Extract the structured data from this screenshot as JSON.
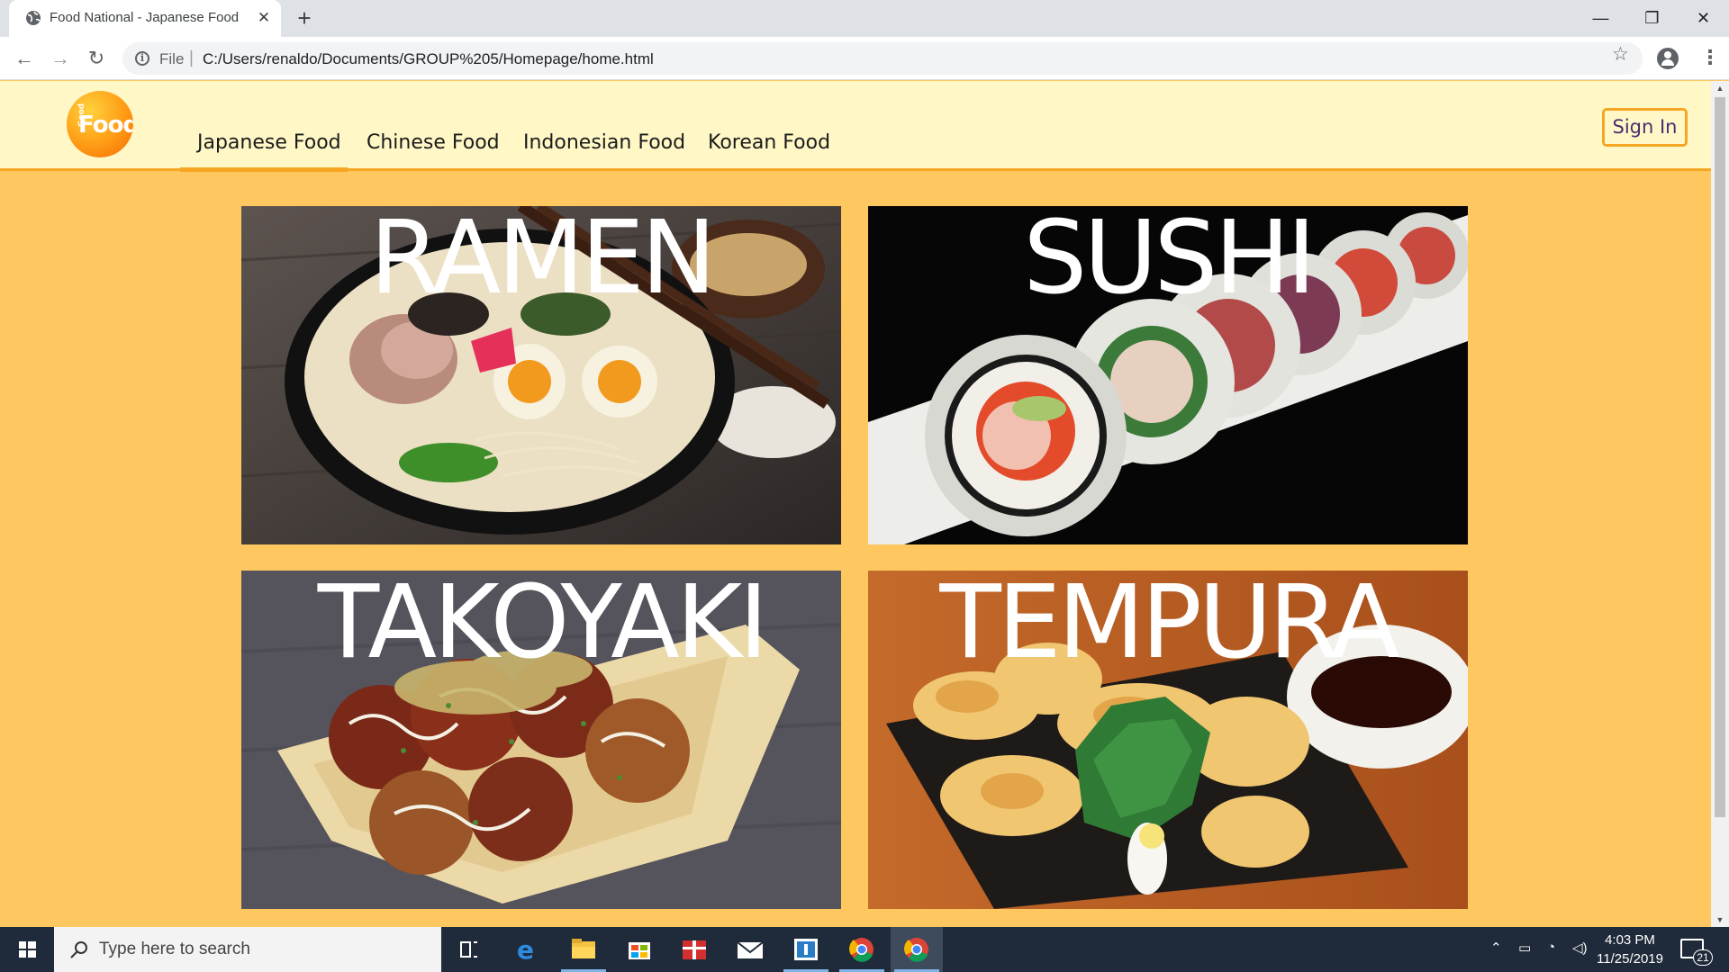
{
  "browser": {
    "tab_title": "Food National - Japanese Food",
    "tab_close": "✕",
    "new_tab": "+",
    "window_controls": {
      "minimize": "—",
      "restore": "❐",
      "close": "✕"
    },
    "scheme_label": "File",
    "url": "C:/Users/renaldo/Documents/GROUP%205/Homepage/home.html",
    "back": "←",
    "forward": "→",
    "reload": "↻",
    "star": "☆",
    "menu": "⋮"
  },
  "site": {
    "logo_text": "Food",
    "logo_small": "Good",
    "nav": [
      {
        "label": "Japanese Food",
        "active": true
      },
      {
        "label": "Chinese Food",
        "active": false
      },
      {
        "label": "Indonesian Food",
        "active": false
      },
      {
        "label": "Korean Food",
        "active": false
      }
    ],
    "sign_in": "Sign In",
    "accent_color": "#f5a623",
    "page_bg": "#ffc760",
    "header_bg": "#fff8c6"
  },
  "cards": [
    {
      "title": "RAMEN"
    },
    {
      "title": "SUSHI"
    },
    {
      "title": "TAKOYAKI"
    },
    {
      "title": "TEMPURA"
    }
  ],
  "taskbar": {
    "search_placeholder": "Type here to search",
    "time": "4:03 PM",
    "date": "11/25/2019",
    "notification_count": "21",
    "apps": [
      "task-view-icon",
      "edge-icon",
      "file-explorer-icon",
      "store-icon",
      "gift-icon",
      "mail-icon",
      "app-icon",
      "chrome-icon",
      "chrome-icon"
    ]
  }
}
